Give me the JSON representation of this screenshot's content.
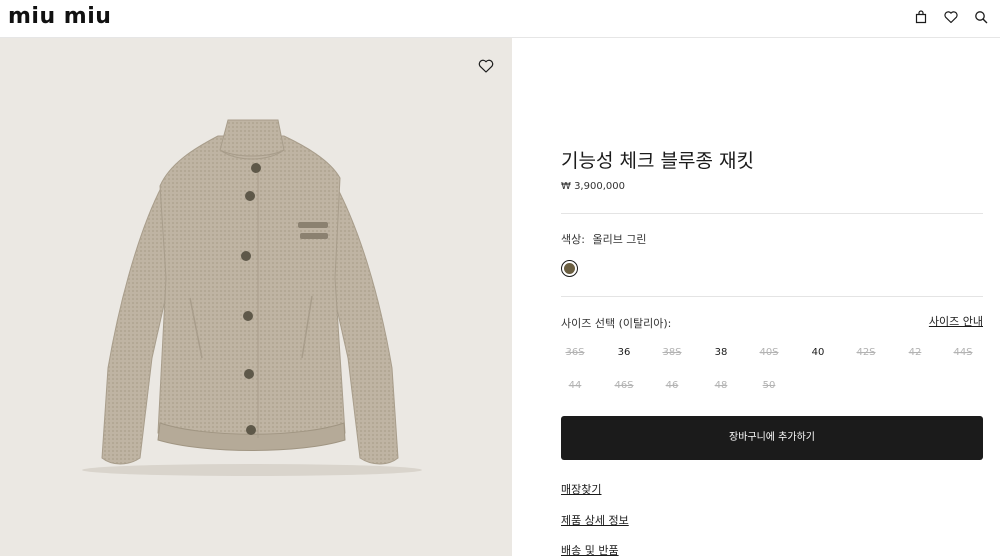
{
  "header": {
    "logo": "miu miu",
    "icons": [
      "shopping-bag-icon",
      "heart-icon",
      "search-icon"
    ]
  },
  "product_image": {
    "alt": "올리브 그린 기능성 체크 블루종 재킷",
    "jacket_color": "#bfb4a3",
    "wishlist_icon": "heart-icon"
  },
  "product": {
    "title": "기능성 체크 블루종 재킷",
    "price": "₩ 3,900,000",
    "color_label": "색상:",
    "color_name": "올리브 그린",
    "color_hex": "#6b5f42",
    "size_label": "사이즈 선택 (이탈리아):",
    "size_guide": "사이즈 안내",
    "sizes": [
      {
        "label": "36S",
        "available": false
      },
      {
        "label": "36",
        "available": true
      },
      {
        "label": "38S",
        "available": false
      },
      {
        "label": "38",
        "available": true
      },
      {
        "label": "40S",
        "available": false
      },
      {
        "label": "40",
        "available": true
      },
      {
        "label": "42S",
        "available": false
      },
      {
        "label": "42",
        "available": false
      },
      {
        "label": "44S",
        "available": false
      },
      {
        "label": "44",
        "available": false
      },
      {
        "label": "46S",
        "available": false
      },
      {
        "label": "46",
        "available": false
      },
      {
        "label": "48",
        "available": false
      },
      {
        "label": "50",
        "available": false
      }
    ],
    "add_to_cart": "장바구니에 추가하기",
    "links": [
      "매장찾기",
      "제품 상세 정보",
      "배송 및 반품"
    ]
  },
  "colors": {
    "button_bg": "#1b1b1b",
    "image_bg": "#ebe8e3",
    "disabled_text": "#b3b3b3"
  }
}
